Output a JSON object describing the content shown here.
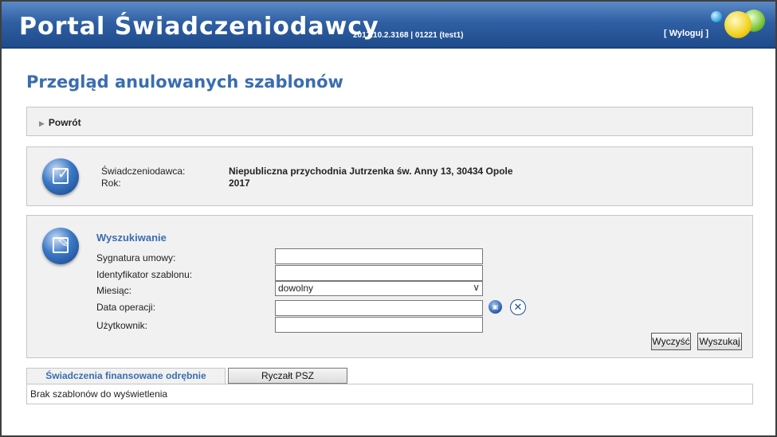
{
  "header": {
    "title": "Portal Świadczeniodawcy",
    "version": "2017.10.2.3168 | 01221 (test1)",
    "logout_label": "[ Wyloguj ]"
  },
  "page": {
    "title": "Przegląd anulowanych szablonów"
  },
  "back": {
    "label": "Powrót"
  },
  "info": {
    "provider_label": "Świadczeniodawca:",
    "provider_value": "Niepubliczna przychodnia Jutrzenka św. Anny 13, 30434 Opole",
    "year_label": "Rok:",
    "year_value": "2017"
  },
  "search": {
    "heading": "Wyszukiwanie",
    "fields": {
      "contract_label": "Sygnatura umowy:",
      "contract_value": "",
      "template_id_label": "Identyfikator szablonu:",
      "template_id_value": "",
      "month_label": "Miesiąc:",
      "month_value": "dowolny",
      "operation_date_label": "Data operacji:",
      "operation_date_value": "",
      "user_label": "Użytkownik:",
      "user_value": ""
    },
    "clear_label": "Wyczyść",
    "search_label": "Wyszukaj"
  },
  "tabs": [
    {
      "label": "Świadczenia finansowane odrębnie",
      "active": true
    },
    {
      "label": "Ryczałt PSZ",
      "active": false
    }
  ],
  "results": {
    "empty_message": "Brak szablonów do wyświetlenia"
  },
  "colors": {
    "header_blue": "#2f5fa3",
    "accent_blue": "#3a6db0",
    "panel_bg": "#f1f1f1"
  }
}
